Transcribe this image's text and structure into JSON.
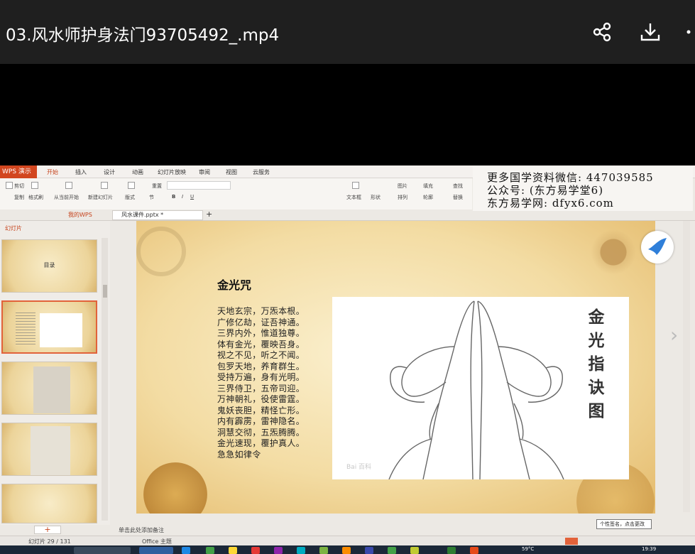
{
  "player": {
    "title": "03.风水师护身法门93705492_.mp4",
    "icons": [
      "share-icon",
      "download-icon",
      "more-icon"
    ]
  },
  "wps": {
    "app_label": "WPS 演示",
    "tabs": [
      "开始",
      "插入",
      "设计",
      "动画",
      "幻灯片放映",
      "审阅",
      "视图",
      "云服务"
    ],
    "active_tab": "开始",
    "ribbon_labels": {
      "cut": "剪切",
      "copy": "复制",
      "format_painter": "格式刷",
      "from_current": "从当前开始",
      "new_slide": "新建幻灯片",
      "layout": "版式",
      "section": "节",
      "reset": "重置",
      "textbox": "文本框",
      "shape": "形状",
      "picture": "图片",
      "fill": "填充",
      "arrange": "排列",
      "outline": "轮廓",
      "find": "查找",
      "replace": "替换"
    },
    "doc_tabs": {
      "my_wps": "我的WPS",
      "file": "风水课件.pptx *"
    },
    "panel_label": "幻灯片",
    "thumb_texts": [
      "目录"
    ],
    "notes_placeholder": "单击此处添加备注",
    "tooltip": "个性签名，点击更改",
    "status": {
      "slide_counter": "幻灯片 29 / 131",
      "theme": "Office 主题",
      "temp": "59°C",
      "time": "19:39"
    }
  },
  "watermark": {
    "line1": "更多国学资料微信: 447039585",
    "line2": "公众号: (东方易学堂6)",
    "line3": "东方易学网: dfyx6.com"
  },
  "slide": {
    "heading": "金光咒",
    "mantra_lines": [
      "天地玄宗，万炁本根。",
      "广修亿劫，证吾神通。",
      "三界内外，惟道独尊。",
      "体有金光，覆映吾身。",
      "视之不见，听之不闻。",
      "包罗天地，养育群生。",
      "受持万遍，身有光明。",
      "三界侍卫，五帝司迎。",
      "万神朝礼，役使雷霆。",
      "鬼妖丧胆，精怪亡形。",
      "内有霹雳，雷神隐名。",
      "洞慧交彻，五炁腾腾。",
      "金光速现，覆护真人。",
      "急急如律令"
    ],
    "figure_title": [
      "金",
      "光",
      "指",
      "诀",
      "图"
    ],
    "figure_watermark": "Bai 百科"
  }
}
